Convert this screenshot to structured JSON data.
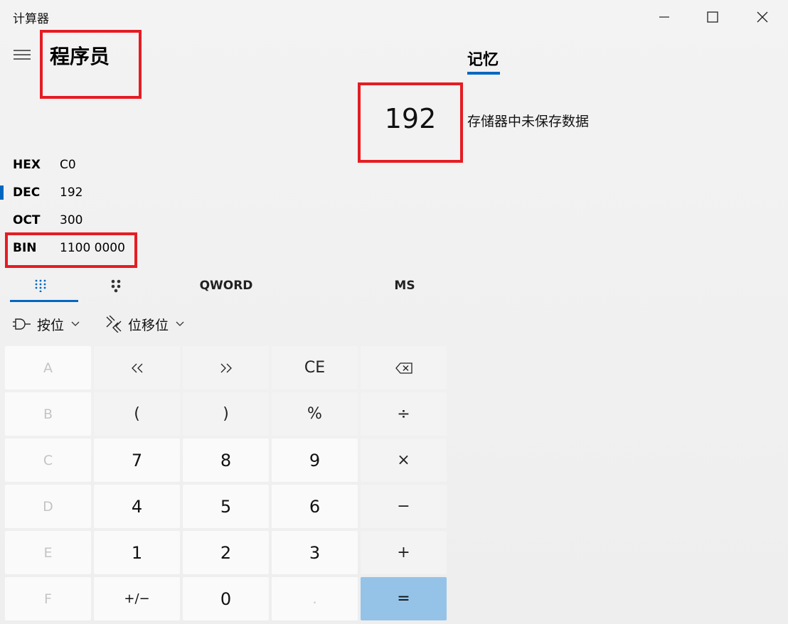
{
  "app": {
    "title": "计算器"
  },
  "header": {
    "mode_title": "程序员",
    "menu_icon": "hamburger-icon"
  },
  "display": {
    "value": "192"
  },
  "memory": {
    "tab_label": "记忆",
    "empty_text": "存储器中未保存数据"
  },
  "radix": [
    {
      "label": "HEX",
      "value": "C0",
      "selected": false
    },
    {
      "label": "DEC",
      "value": "192",
      "selected": true
    },
    {
      "label": "OCT",
      "value": "300",
      "selected": false
    },
    {
      "label": "BIN",
      "value": "1100 0000",
      "selected": false
    }
  ],
  "mode_row": {
    "word_size": "QWORD",
    "memory_store": "MS"
  },
  "operators": {
    "bitwise_label": "按位",
    "shift_label": "位移位"
  },
  "keypad": {
    "rows": [
      [
        "A",
        "<<",
        ">>",
        "CE",
        "⌫"
      ],
      [
        "B",
        "(",
        ")",
        "%",
        "÷"
      ],
      [
        "C",
        "7",
        "8",
        "9",
        "×"
      ],
      [
        "D",
        "4",
        "5",
        "6",
        "−"
      ],
      [
        "E",
        "1",
        "2",
        "3",
        "+"
      ],
      [
        "F",
        "+/−",
        "0",
        ".",
        "="
      ]
    ]
  },
  "colors": {
    "accent": "#0067c0",
    "equals": "#95c3e8",
    "highlight_box": "#e51c23"
  }
}
